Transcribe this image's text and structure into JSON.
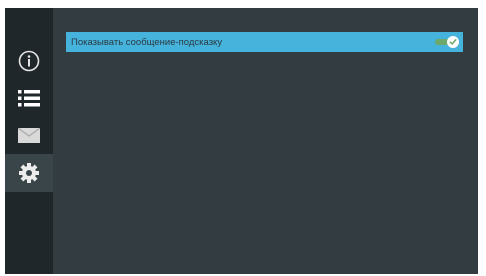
{
  "sidebar": {
    "items": [
      {
        "icon": "info-icon",
        "active": false
      },
      {
        "icon": "list-icon",
        "active": false
      },
      {
        "icon": "envelope-icon",
        "active": false
      },
      {
        "icon": "gear-icon",
        "active": true
      }
    ]
  },
  "settings": {
    "rows": [
      {
        "label": "Показывать сообщение-подсказку",
        "enabled": true,
        "selected": true
      }
    ]
  },
  "colors": {
    "background": "#323c41",
    "sidebar": "#1f272b",
    "highlight": "#46b3dc",
    "toggle_on": "#6ca96a"
  }
}
